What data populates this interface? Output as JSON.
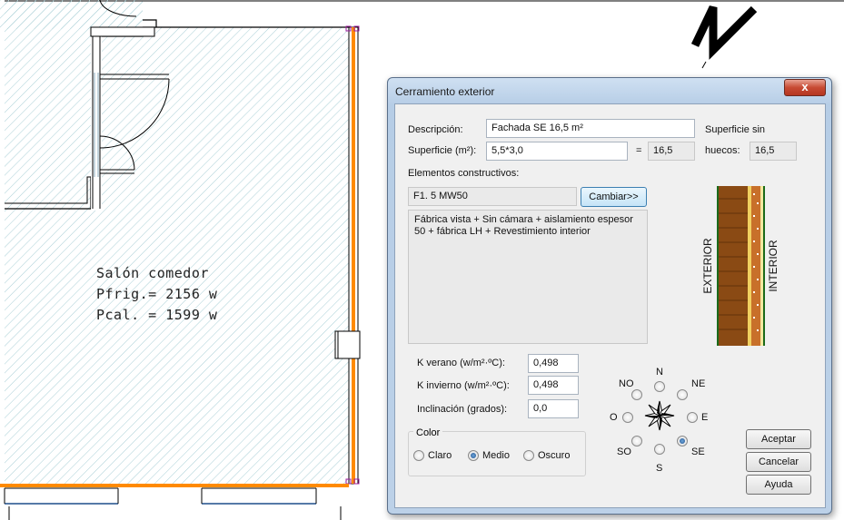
{
  "plan": {
    "room_name": "Salón comedor",
    "pfrig": "Pfrig.= 2156 w",
    "pcal": "Pcal. = 1599 w"
  },
  "dialog": {
    "title": "Cerramiento exterior",
    "close_glyph": "x",
    "descripcion_label": "Descripción:",
    "descripcion_value": "Fachada SE 16,5 m²",
    "superficie_label": "Superficie (m²):",
    "superficie_value": "5,5*3,0",
    "equals": "=",
    "superficie_result": "16,5",
    "sin_huecos_label_1": "Superficie sin",
    "sin_huecos_label_2": "huecos:",
    "sin_huecos_value": "16,5",
    "elementos_label": "Elementos constructivos:",
    "elemento_code": "F1. 5 MW50",
    "cambiar_label": "Cambiar>>",
    "elemento_desc": "Fábrica vista + Sin cámara + aislamiento espesor 50 + fábrica LH + Revestimiento interior",
    "section_exterior": "EXTERIOR",
    "section_interior": "INTERIOR",
    "k_verano_label": "K verano (w/m²·ºC):",
    "k_verano_value": "0,498",
    "k_invierno_label": "K invierno (w/m²·ºC):",
    "k_invierno_value": "0,498",
    "inclinacion_label": "Inclinación (grados):",
    "inclinacion_value": "0,0",
    "color_group": "Color",
    "color_options": [
      "Claro",
      "Medio",
      "Oscuro"
    ],
    "color_selected": "Medio",
    "orientations": {
      "N": "N",
      "NE": "NE",
      "E": "E",
      "SE": "SE",
      "S": "S",
      "SO": "SO",
      "O": "O",
      "NO": "NO"
    },
    "orientation_selected": "SE",
    "aceptar_label": "Aceptar",
    "cancelar_label": "Cancelar",
    "ayuda_label": "Ayuda"
  }
}
